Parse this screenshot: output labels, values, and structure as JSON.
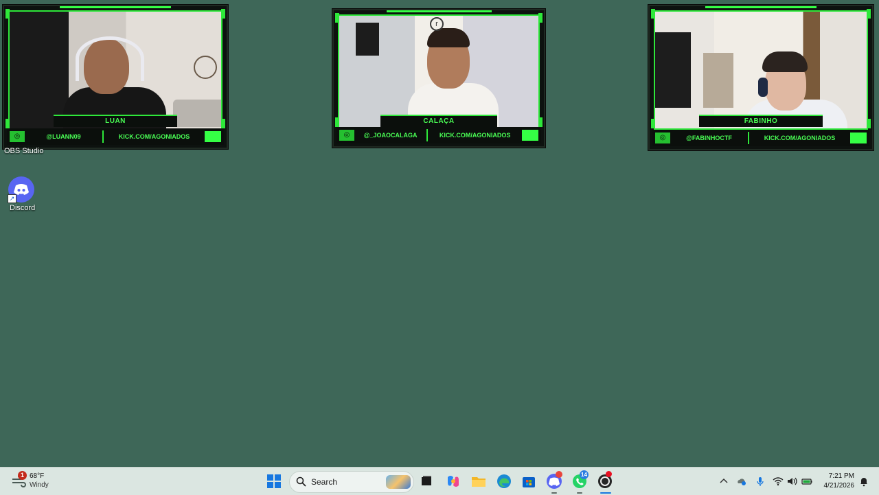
{
  "cams": [
    {
      "name": "LUAN",
      "handle": "@LUANN09",
      "site": "KICK.COM/AGONIADOS"
    },
    {
      "name": "CALAÇA",
      "handle": "@_JOAOCALAGA",
      "site": "KICK.COM/AGONIADOS"
    },
    {
      "name": "FABINHO",
      "handle": "@FABINHOCTF",
      "site": "KICK.COM/AGONIADOS"
    }
  ],
  "desktop": {
    "obs_label": "OBS Studio",
    "discord_label": "Discord"
  },
  "taskbar": {
    "weather": {
      "badge": "1",
      "temp": "68°F",
      "condition": "Windy"
    },
    "search_label": "Search",
    "discord_badge": "",
    "whatsapp_badge": "14",
    "clock": {
      "time": "7:21 PM",
      "date": "4/21/2026"
    }
  },
  "colors": {
    "desktop_bg": "#3e6758",
    "overlay_green": "#2ee83a",
    "taskbar_bg": "#dbe6e1"
  }
}
